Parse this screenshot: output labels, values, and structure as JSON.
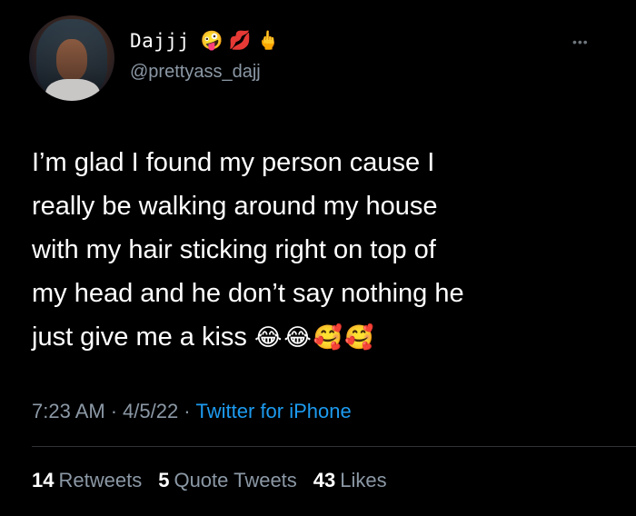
{
  "tweet": {
    "author": {
      "display_name": "Dajjj",
      "name_emojis": [
        "🤪",
        "💋",
        "🖕"
      ],
      "handle": "@prettyass_dajj"
    },
    "more_label": "•••",
    "text_lines": [
      "I’m glad I found my person cause I",
      "really be walking around my house",
      "with my hair sticking right on top of",
      "my head and he don’t say nothing he",
      "just give me a kiss"
    ],
    "text_emojis": "😂😂🥰🥰",
    "time": "7:23 AM",
    "date": "4/5/22",
    "separator": "·",
    "source": "Twitter for iPhone",
    "stats": {
      "retweets_count": "14",
      "retweets_label": "Retweets",
      "quotes_count": "5",
      "quotes_label": "Quote Tweets",
      "likes_count": "43",
      "likes_label": "Likes"
    }
  },
  "colors": {
    "background": "#000000",
    "text": "#ffffff",
    "secondary": "#8b98a5",
    "link": "#1d9bf0",
    "divider": "#2f3336"
  }
}
